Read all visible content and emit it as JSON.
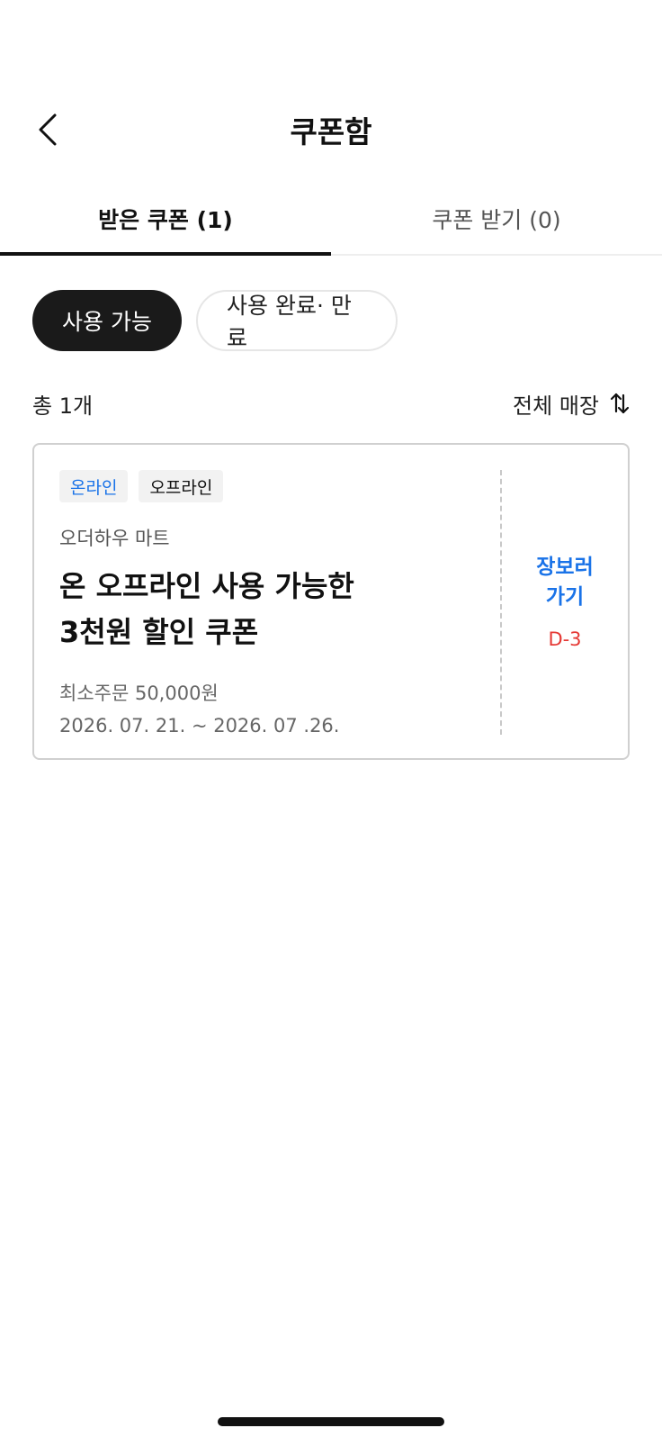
{
  "header": {
    "title": "쿠폰함",
    "back_icon": "chevron-left-icon"
  },
  "tabs": [
    {
      "label": "받은 쿠폰 (1)",
      "active": true
    },
    {
      "label": "쿠폰 받기 (0)",
      "active": false
    }
  ],
  "filters": [
    {
      "label": "사용 가능",
      "active": true
    },
    {
      "label": "사용 완료· 만료",
      "active": false
    }
  ],
  "summary": {
    "total": "총 1개",
    "store_filter": "전체 매장",
    "sort_icon": "sort-arrows-icon"
  },
  "coupon": {
    "tags": [
      "온라인",
      "오프라인"
    ],
    "store": "오더하우 마트",
    "title_line1": "온 오프라인 사용 가능한",
    "title_line2": "3천원 할인 쿠폰",
    "min_order": "최소주문 50,000원",
    "period": "2026. 07. 21. ~ 2026. 07 .26.",
    "action_line1": "장보러",
    "action_line2": "가기",
    "dday": "D-3"
  },
  "colors": {
    "accent_blue": "#1a73e8",
    "dday_red": "#e53935",
    "active_chip": "#1a1a1a"
  }
}
